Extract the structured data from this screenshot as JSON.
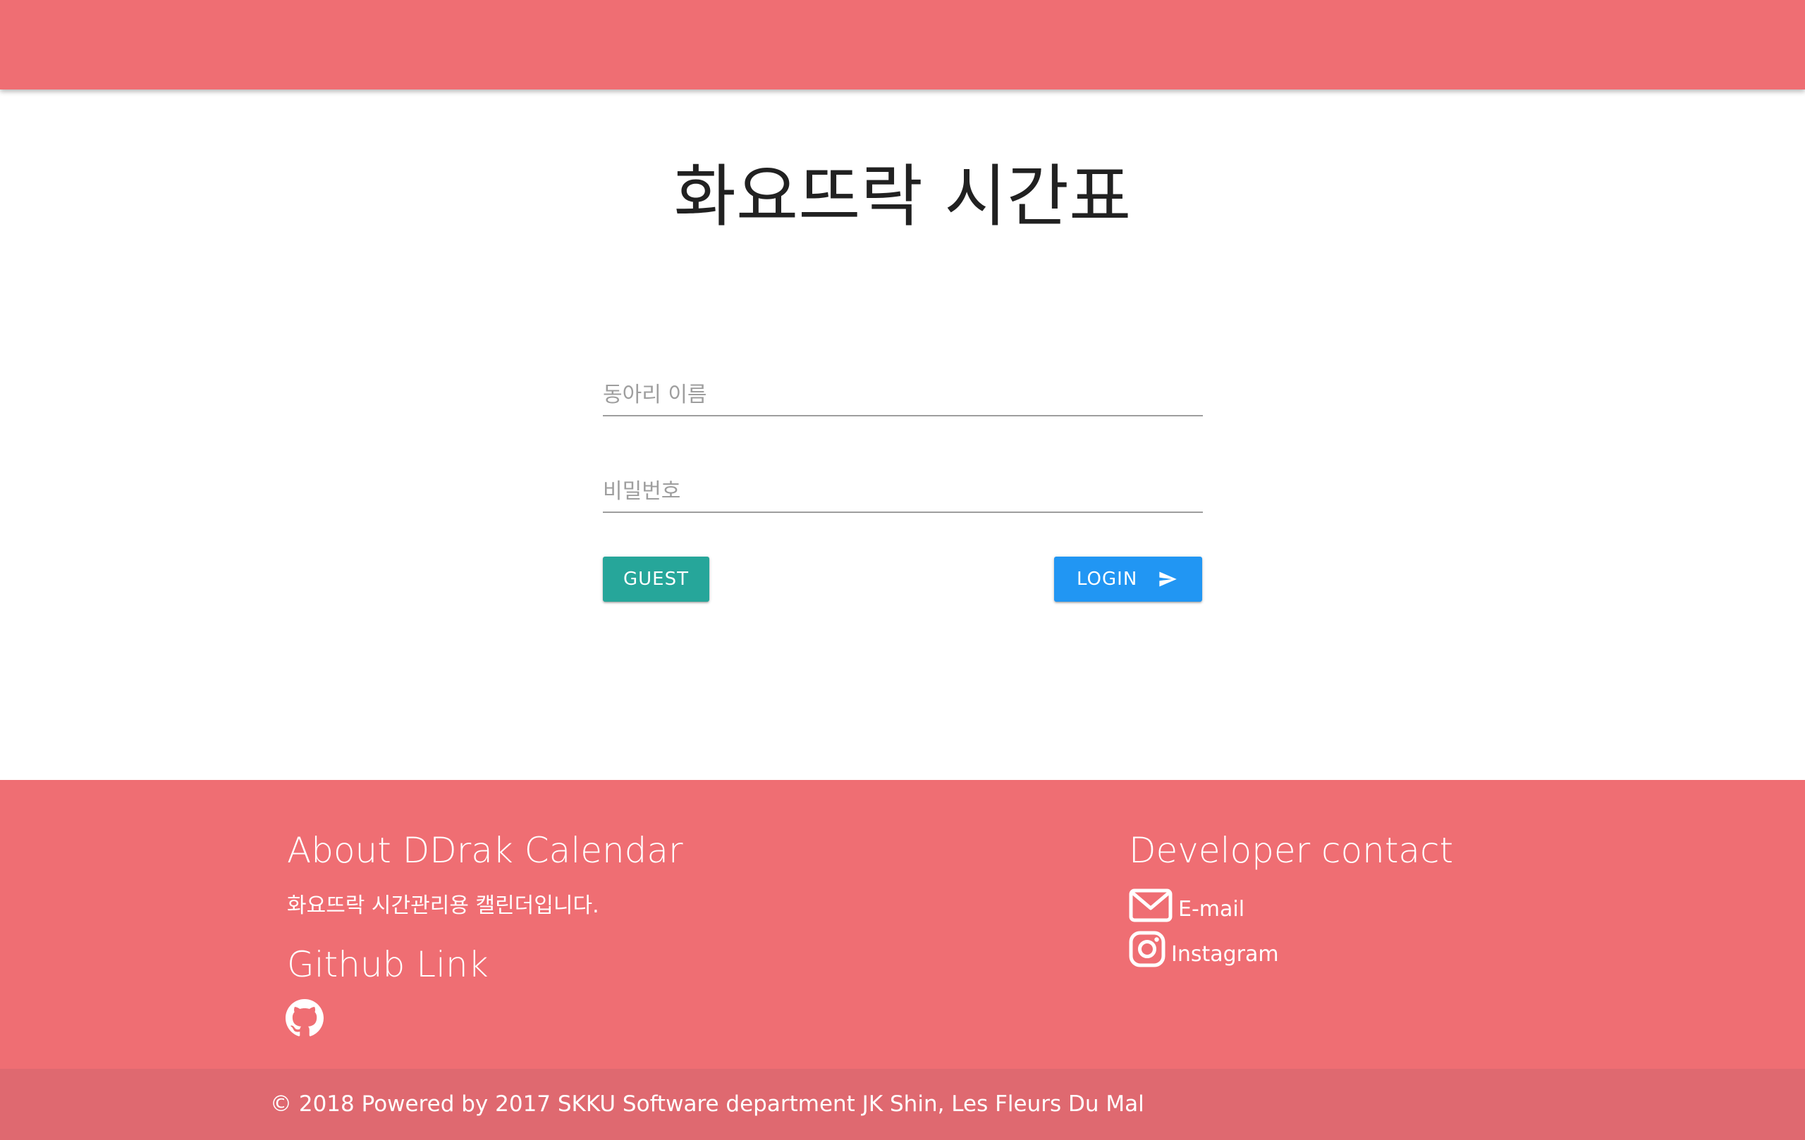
{
  "colors": {
    "brand": "#ef6e73",
    "footer_copyright_bg": "#df6970",
    "guest_button": "#26a69a",
    "login_button": "#2196f3"
  },
  "login": {
    "title": "화요뜨락 시간표",
    "club_name_placeholder": "동아리 이름",
    "password_placeholder": "비밀번호",
    "guest_label": "GUEST",
    "login_label": "LOGIN",
    "login_icon": "send-icon"
  },
  "footer": {
    "about_heading": "About DDrak Calendar",
    "about_text": "화요뜨락 시간관리용 캘린더입니다.",
    "github_heading": "Github Link",
    "github_icon": "github-icon",
    "contact_heading": "Developer contact",
    "contacts": [
      {
        "icon": "mail-icon",
        "label": "E-mail"
      },
      {
        "icon": "instagram-icon",
        "label": "Instagram"
      }
    ],
    "copyright": "© 2018 Powered by 2017 SKKU Software department JK Shin, Les Fleurs Du Mal"
  }
}
